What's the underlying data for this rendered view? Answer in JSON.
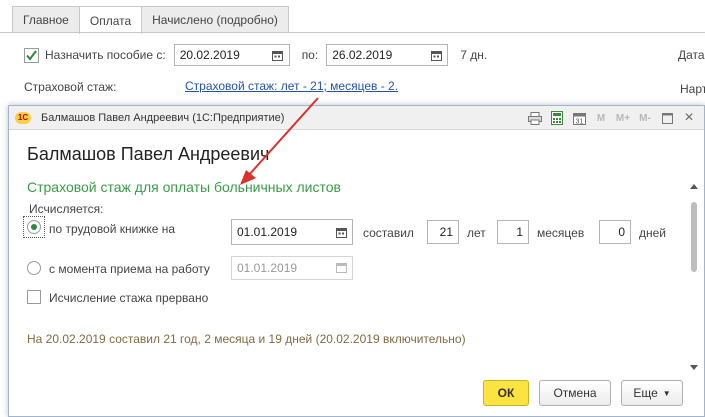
{
  "background_form": {
    "tabs": [
      "Главное",
      "Оплата",
      "Начислено (подробно)"
    ],
    "assign_benefit_label": "Назначить пособие с:",
    "assign_benefit_checked": true,
    "date_from": "20.02.2019",
    "to_label": "по:",
    "date_to": "26.02.2019",
    "days": "7 дн.",
    "right_label_1": "Дата",
    "insurance_label": "Страховой стаж:",
    "insurance_link": "Страховой стаж: лет - 21; месяцев - 2.",
    "right_label_2": "Нарт"
  },
  "dialog": {
    "window_title": "Балмашов Павел Андреевич  (1С:Предприятие)",
    "logo_text": "1С",
    "toolbar_icons": [
      "printer-icon",
      "calculator-icon",
      "calendar-icon",
      "m-icon",
      "m-plus-icon",
      "m-minus-icon",
      "restore-icon",
      "close-icon"
    ],
    "toolbar_icon_text": {
      "m": "M",
      "mplus": "M+",
      "mminus": "M-",
      "close": "×"
    },
    "heading": "Балмашов Павел Андреевич",
    "section_title": "Страховой стаж для оплаты больничных листов",
    "calculated_label": "Исчисляется:",
    "option_workbook": {
      "label": "по трудовой книжке на",
      "selected": true,
      "date": "01.01.2019",
      "amounted_label": "составил",
      "years": "21",
      "years_label": "лет",
      "months": "1",
      "months_label": "месяцев",
      "days": "0",
      "days_label": "дней"
    },
    "option_hire": {
      "label": "с момента приема на работу",
      "selected": false,
      "date": "01.01.2019"
    },
    "interrupted_label": "Исчисление стажа прервано",
    "interrupted_checked": false,
    "summary": "На 20.02.2019 составил 21 год, 2 месяца и 19 дней (20.02.2019 включительно)",
    "buttons": {
      "ok": "ОК",
      "cancel": "Отмена",
      "more": "Еще"
    }
  },
  "colors": {
    "accent_green": "#3a9c48",
    "link_blue": "#2452a8",
    "ok_yellow": "#fbe341",
    "summary_brown": "#806a40",
    "callout_red": "#d9312b"
  }
}
